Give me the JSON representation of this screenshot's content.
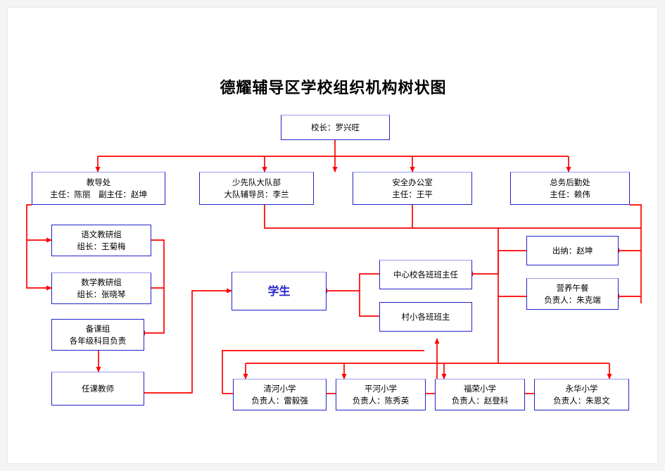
{
  "meta": {
    "title": "德耀辅导区学校组织机构树状图",
    "accent_line_color": "#ff0000",
    "box_border_color": "#2222cc",
    "page_bg": "#ffffff",
    "outer_bg": "#f4f4f4",
    "student_text_color": "#2222cc"
  },
  "chart_data": {
    "type": "diagram",
    "diagram_kind": "organization-tree",
    "title": "德耀辅导区学校组织机构树状图"
  },
  "nodes": {
    "principal": {
      "line1": "校长：罗兴旺",
      "line2": ""
    },
    "dept_teach": {
      "line1": "教导处",
      "line2": "主任：陈丽　副主任：赵坤"
    },
    "dept_youth": {
      "line1": "少先队大队部",
      "line2": "大队辅导员：李兰"
    },
    "dept_safety": {
      "line1": "安全办公室",
      "line2": "主任：王平"
    },
    "dept_logi": {
      "line1": "总务后勤处",
      "line2": "主任：赖伟"
    },
    "group_chinese": {
      "line1": "语文教研组",
      "line2": "组长：王菊梅"
    },
    "group_math": {
      "line1": "数学教研组",
      "line2": "组长：张晓琴"
    },
    "group_prep": {
      "line1": "备课组",
      "line2": "各年级科目负责"
    },
    "teachers": {
      "line1": "任课教师",
      "line2": ""
    },
    "students": {
      "line1": "学生",
      "line2": ""
    },
    "center_class": {
      "line1": "中心校各班班主任",
      "line2": ""
    },
    "village_class": {
      "line1": "村小各班班主",
      "line2": ""
    },
    "cashier": {
      "line1": "出纳：赵坤",
      "line2": ""
    },
    "lunch": {
      "line1": "营养午餐",
      "line2": "负责人：朱克端"
    },
    "school_qinghe": {
      "line1": "清河小学",
      "line2": "负责人：雷毅强"
    },
    "school_pinghe": {
      "line1": "平河小学",
      "line2": "负责人：陈秀英"
    },
    "school_furong": {
      "line1": "福荣小学",
      "line2": "负责人：赵登科"
    },
    "school_yonghua": {
      "line1": "永华小学",
      "line2": "负责人：朱恩文"
    }
  }
}
